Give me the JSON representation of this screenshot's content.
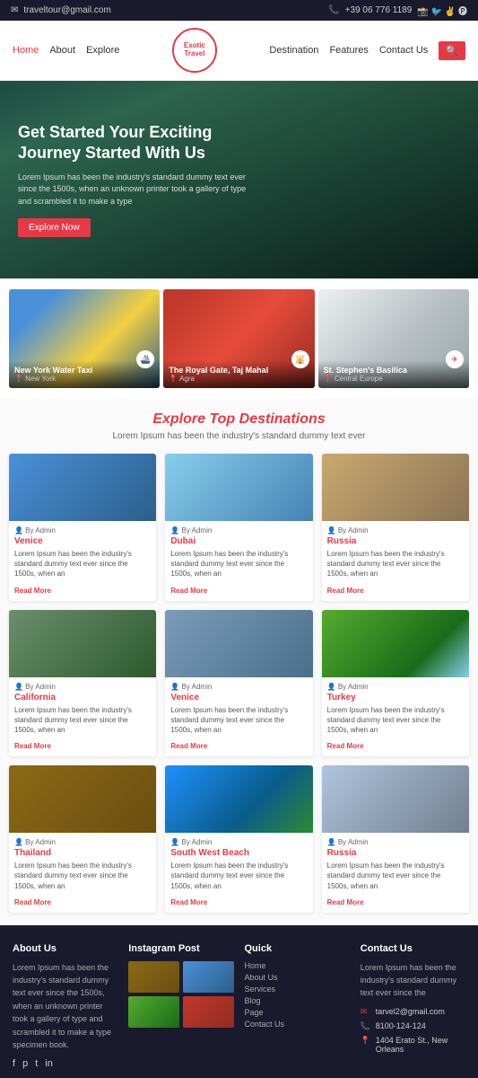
{
  "topbar": {
    "email": "traveltour@gmail.com",
    "phone": "+39 06 776 1189"
  },
  "nav": {
    "logo_line1": "Exotic",
    "logo_line2": "Travel",
    "links": [
      "Home",
      "About",
      "Explore",
      "Destination",
      "Features",
      "Contact Us"
    ]
  },
  "hero": {
    "title": "Get Started Your Exciting Journey Started With Us",
    "description": "Lorem Ipsum has been the industry's standard dummy text ever since the 1500s, when an unknown printer took a gallery of type and scrambled it to make a type",
    "button_label": "Explore Now"
  },
  "featured": [
    {
      "name": "New York Water Taxi",
      "location": "New York",
      "icon": "🚢"
    },
    {
      "name": "The Royal Gate, Taj Mahal",
      "location": "Agra",
      "icon": "🕌"
    },
    {
      "name": "St. Stephen's Basilica",
      "location": "Central Europe",
      "icon": "✈"
    }
  ],
  "destinations": {
    "title": "Explore Top Destinations",
    "subtitle": "Lorem Ipsum has been the industry's standard dummy text ever",
    "cards": [
      {
        "author": "By Admin",
        "name": "Venice",
        "desc": "Lorem Ipsum has been the industry's standard dummy text ever since the 1500s, when an",
        "img_class": "img-venice"
      },
      {
        "author": "By Admin",
        "name": "Dubai",
        "desc": "Lorem Ipsum has been the industry's standard dummy text ever since the 1500s, when an",
        "img_class": "img-dubai"
      },
      {
        "author": "By Admin",
        "name": "Russia",
        "desc": "Lorem Ipsum has been the industry's standard dummy text ever since the 1500s, when an",
        "img_class": "img-russia"
      },
      {
        "author": "By Admin",
        "name": "California",
        "desc": "Lorem Ipsum has been the industry's standard dummy text ever since the 1500s, when an",
        "img_class": "img-california"
      },
      {
        "author": "By Admin",
        "name": "Venice",
        "desc": "Lorem Ipsum has been the industry's standard dummy text ever since the 1500s, when an",
        "img_class": "img-venice2"
      },
      {
        "author": "By Admin",
        "name": "Turkey",
        "desc": "Lorem Ipsum has been the industry's standard dummy text ever since the 1500s, when an",
        "img_class": "img-turkey"
      },
      {
        "author": "By Admin",
        "name": "Thailand",
        "desc": "Lorem Ipsum has been the industry's standard dummy text ever since the 1500s, when an",
        "img_class": "img-thailand"
      },
      {
        "author": "By Admin",
        "name": "South West Beach",
        "desc": "Lorem Ipsum has been the industry's standard dummy text ever since the 1500s, when an",
        "img_class": "img-swbeach"
      },
      {
        "author": "By Admin",
        "name": "Russia",
        "desc": "Lorem Ipsum has been the industry's standard dummy text ever since the 1500s, when an",
        "img_class": "img-russia2"
      }
    ],
    "read_more": "Read More"
  },
  "footer": {
    "about_title": "About Us",
    "about_text": "Lorem Ipsum has been the industry's standard dummy text ever since the 1500s, when an unknown printer took a gallery of type and scrambled it to make a type specimen book.",
    "instagram_title": "Instagram Post",
    "quick_title": "Quick",
    "quick_links": [
      "Home",
      "About Us",
      "Services",
      "Blog",
      "Page",
      "Contact Us"
    ],
    "contact_title": "Contact Us",
    "contact_text": "Lorem Ipsum has been the industry's standard dummy text ever since the",
    "contact_email": "tarvel2@gmail.com",
    "contact_phone": "8100-124-124",
    "contact_address": "1404 Erato St., New Orleans"
  }
}
